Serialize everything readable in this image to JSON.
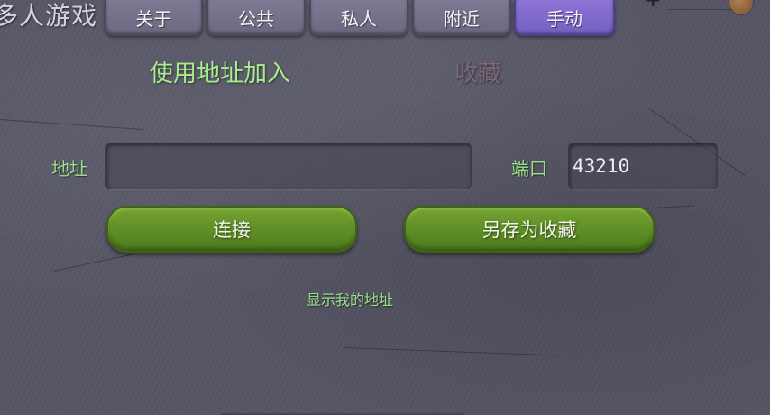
{
  "app_title": "多人游戏",
  "tabs": [
    {
      "label": "关于"
    },
    {
      "label": "公共"
    },
    {
      "label": "私人"
    },
    {
      "label": "附近"
    },
    {
      "label": "手动"
    }
  ],
  "active_tab": "手动",
  "sub_tabs": {
    "join_by_address": "使用地址加入",
    "favorites": "收藏"
  },
  "form": {
    "address_label": "地址",
    "address_value": "",
    "port_label": "端口",
    "port_value": "43210"
  },
  "buttons": {
    "connect": "连接",
    "save_favorite": "另存为收藏"
  },
  "show_my_address": "显示我的地址",
  "colors": {
    "background": "#575666",
    "tab": "#7d7b93",
    "tab_active": "#8d74d6",
    "accent_green_text": "#a6ef8e",
    "button_green": "#5f8d26"
  },
  "icons": {
    "corner_left": "plus-icon",
    "corner_right": "coin-icon"
  }
}
